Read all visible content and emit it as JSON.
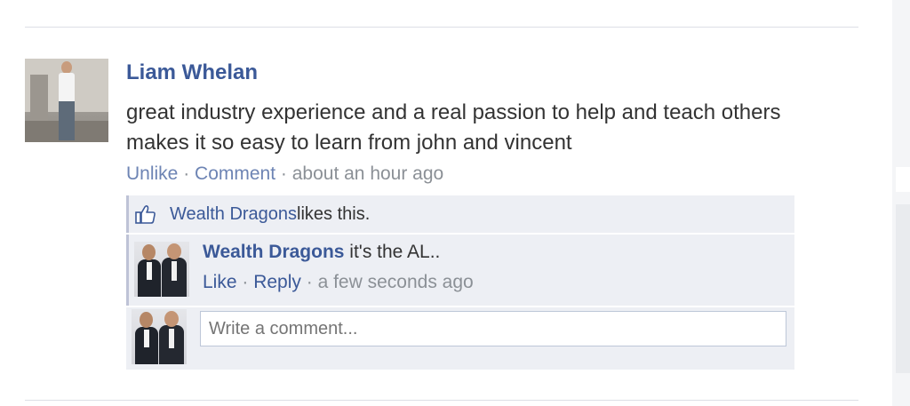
{
  "post": {
    "author": "Liam Whelan",
    "text": "great industry experience and a real passion to help and teach others makes it so easy to learn from john and vincent",
    "actions": {
      "unlike": "Unlike",
      "dot1": " · ",
      "comment": "Comment",
      "dot2": " · ",
      "timestamp": "about an hour ago"
    }
  },
  "likes": {
    "liker": "Wealth Dragons",
    "suffix": " likes this."
  },
  "comment": {
    "author": "Wealth Dragons",
    "text": " it's the AL..",
    "actions": {
      "like": "Like",
      "dot1": " · ",
      "reply": "Reply",
      "dot2": " · ",
      "timestamp": "a few seconds ago"
    }
  },
  "composer": {
    "placeholder": "Write a comment..."
  },
  "icons": {
    "thumb": "thumbs-up-icon"
  },
  "colors": {
    "link": "#3b5998",
    "action_link": "#6d84b4",
    "meta": "#8b9096",
    "ufi_bg": "#edeff4"
  }
}
